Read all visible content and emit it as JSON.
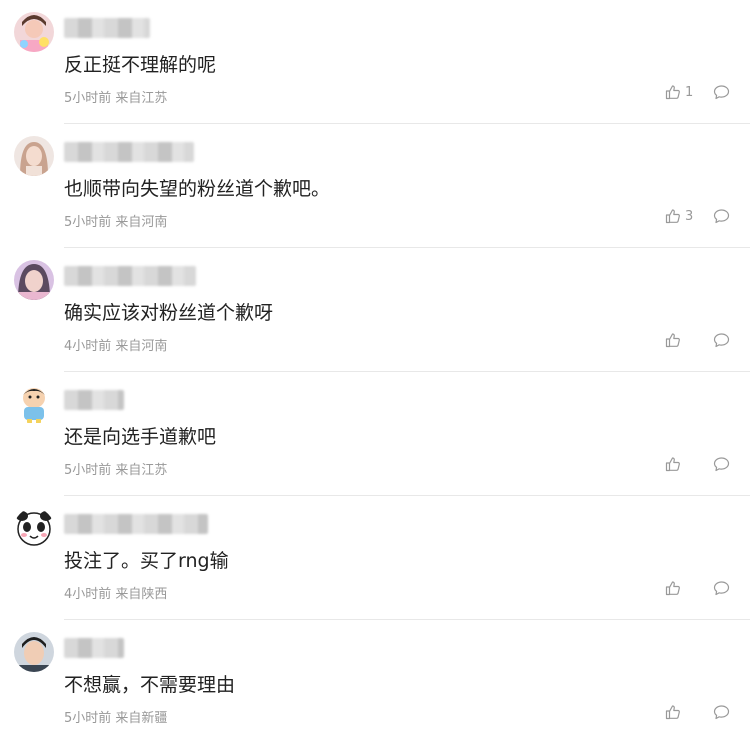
{
  "comments": [
    {
      "text": "反正挺不理解的呢",
      "time": "5小时前",
      "location": "来自江苏",
      "likes": "1",
      "avatar": "girl-photo"
    },
    {
      "text": "也顺带向失望的粉丝道个歉吧。",
      "time": "5小时前",
      "location": "来自河南",
      "likes": "3",
      "avatar": "girl-photo"
    },
    {
      "text": "确实应该对粉丝道个歉呀",
      "time": "4小时前",
      "location": "来自河南",
      "likes": "",
      "avatar": "girl-photo"
    },
    {
      "text": "还是向选手道歉吧",
      "time": "5小时前",
      "location": "来自江苏",
      "likes": "",
      "avatar": "cartoon-boy"
    },
    {
      "text": "投注了。买了rng输",
      "time": "4小时前",
      "location": "来自陕西",
      "likes": "",
      "avatar": "panda-face"
    },
    {
      "text": "不想赢，不需要理由",
      "time": "5小时前",
      "location": "来自新疆",
      "likes": "",
      "avatar": "man-photo"
    }
  ],
  "icons": {
    "like": "thumbs-up-icon",
    "reply": "comment-bubble-icon"
  },
  "colors": {
    "text": "#222222",
    "meta": "#999999",
    "divider": "#e8e8e8"
  }
}
